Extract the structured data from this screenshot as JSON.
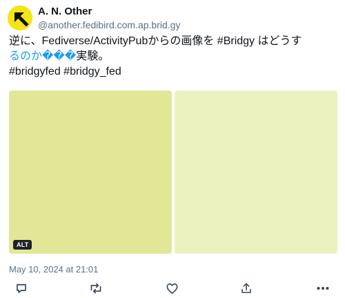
{
  "author": {
    "display_name": "A. N. Other",
    "handle": "@another.fedibird.com.ap.brid.gy",
    "avatar_icon": "arrow-up-left-icon",
    "avatar_color": "#f4e616"
  },
  "post": {
    "line1": "逆に、Fediverse/ActivityPubからの画像を #Bridgy はどうす",
    "line2_link": "るのか",
    "line2_glyphs": "���",
    "line2_rest": "実験。",
    "hashtag1": "#bridgyfed",
    "hashtag2": "#bridgy_fed"
  },
  "media": {
    "images": [
      {
        "color": "#e1e797",
        "alt_label": "ALT"
      },
      {
        "color": "#ecf1c0"
      }
    ]
  },
  "timestamp": "May 10, 2024 at 21:01",
  "actions": {
    "reply_icon": "reply-icon",
    "repost_icon": "repost-icon",
    "like_icon": "heart-icon",
    "share_icon": "share-icon",
    "more_icon": "more-icon"
  },
  "colors": {
    "link": "#1d9bf0",
    "muted": "#5b7083",
    "text": "#0f1419"
  }
}
